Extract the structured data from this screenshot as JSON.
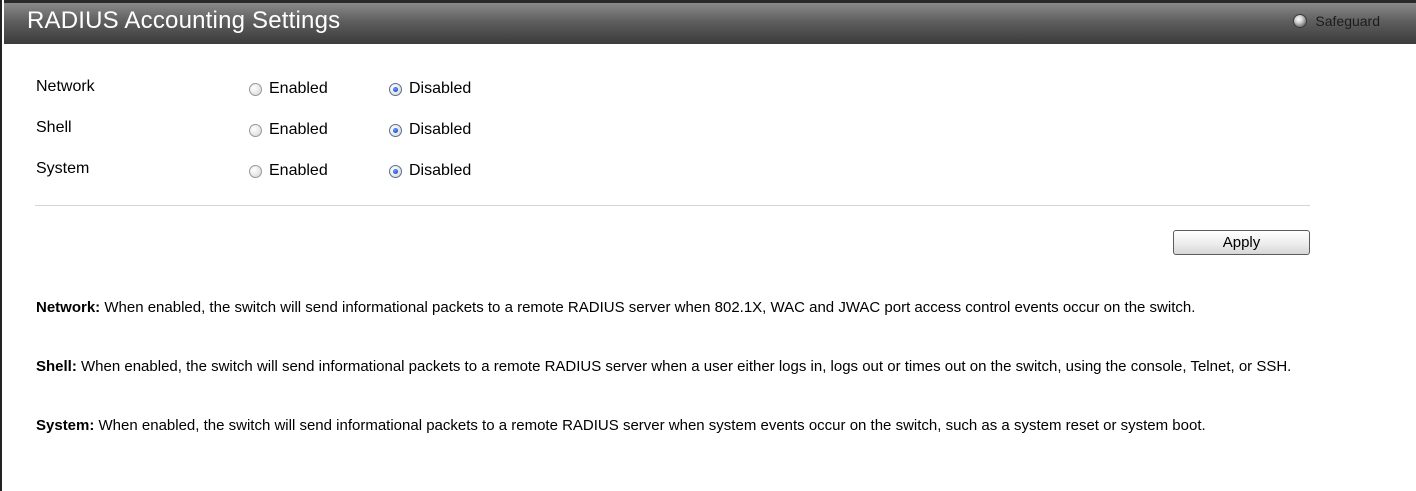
{
  "header": {
    "title": "RADIUS Accounting Settings",
    "safeguard_label": "Safeguard"
  },
  "settings": [
    {
      "label": "Network",
      "enabled_label": "Enabled",
      "disabled_label": "Disabled",
      "selected": "Disabled"
    },
    {
      "label": "Shell",
      "enabled_label": "Enabled",
      "disabled_label": "Disabled",
      "selected": "Disabled"
    },
    {
      "label": "System",
      "enabled_label": "Enabled",
      "disabled_label": "Disabled",
      "selected": "Disabled"
    }
  ],
  "actions": {
    "apply_label": "Apply"
  },
  "help": [
    {
      "term": "Network:",
      "text": " When enabled, the switch will send informational packets to a remote RADIUS server when 802.1X, WAC and JWAC port access control events occur on the switch."
    },
    {
      "term": "Shell:",
      "text": " When enabled, the switch will send informational packets to a remote RADIUS server when a user either logs in, logs out or times out on the switch, using the console, Telnet, or SSH."
    },
    {
      "term": "System:",
      "text": " When enabled, the switch will send informational packets to a remote RADIUS server when system events occur on the switch, such as a system reset or system boot."
    }
  ]
}
